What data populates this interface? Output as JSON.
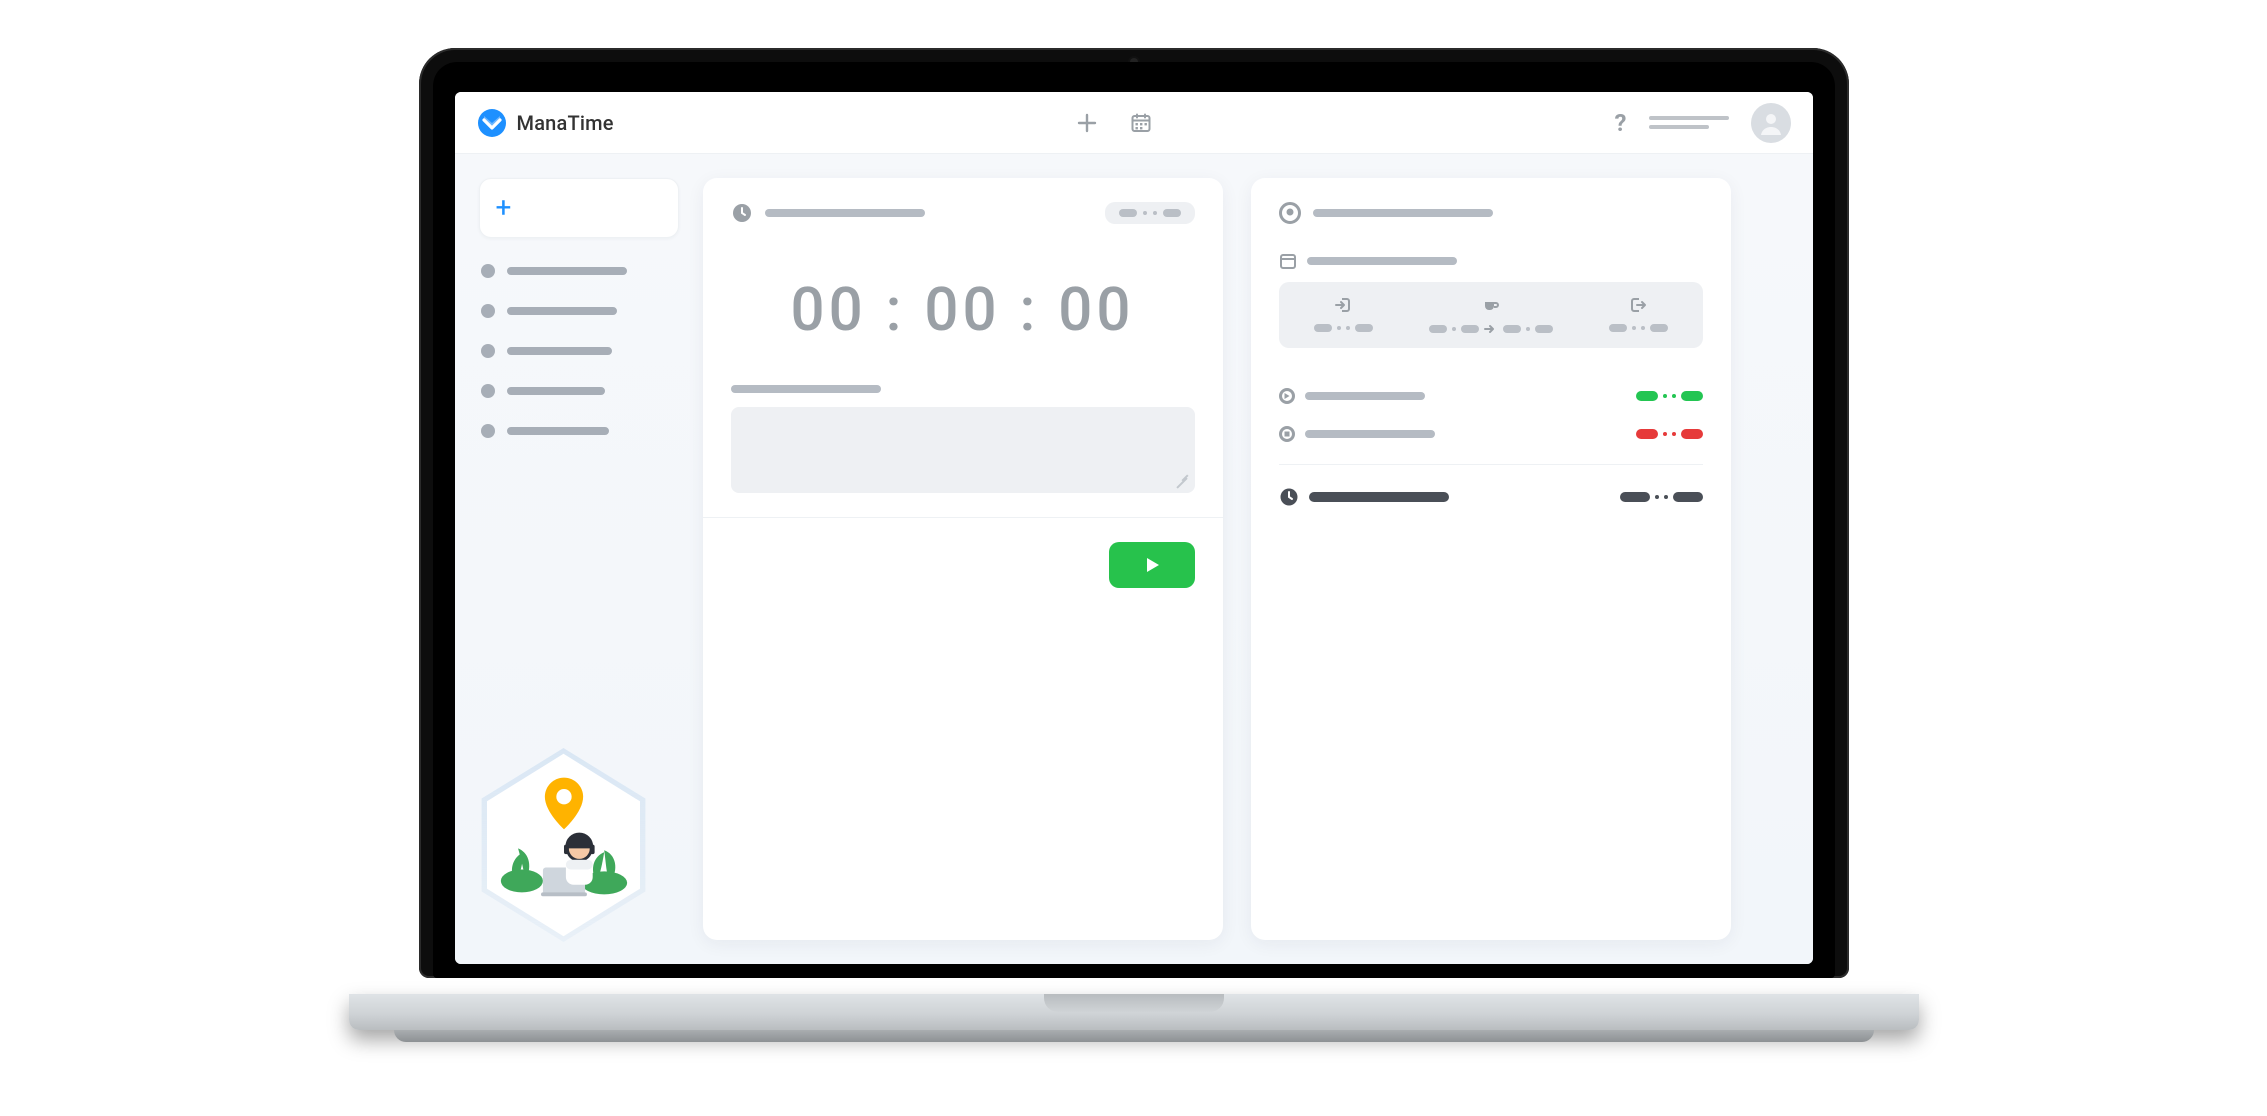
{
  "brand": {
    "name": "ManaTime"
  },
  "topbar": {
    "add_tooltip": "Add",
    "calendar_tooltip": "Calendar",
    "help_label": "?",
    "user_menu_tooltip": "Account"
  },
  "sidebar": {
    "add_label": "+",
    "items": [
      {
        "label": ""
      },
      {
        "label": ""
      },
      {
        "label": ""
      },
      {
        "label": ""
      },
      {
        "label": ""
      }
    ]
  },
  "timer": {
    "heading": "",
    "badge": "",
    "display": "00 : 00 : 00",
    "note_label": "",
    "note_placeholder": "",
    "start_tooltip": "Start"
  },
  "summary": {
    "user_heading": "",
    "schedule_heading": "",
    "schedule": {
      "checkin_label": "",
      "checkin_value": "",
      "break_label": "",
      "break_value": "",
      "checkout_label": "",
      "checkout_value": ""
    },
    "worked_label": "",
    "worked_value": "",
    "paused_label": "",
    "paused_value": "",
    "total_label": "",
    "total_value": ""
  },
  "colors": {
    "accent": "#1e90ff",
    "success": "#27c24c",
    "danger": "#e63a3a",
    "muted": "#9aa0a6",
    "dark": "#4a4f57"
  }
}
